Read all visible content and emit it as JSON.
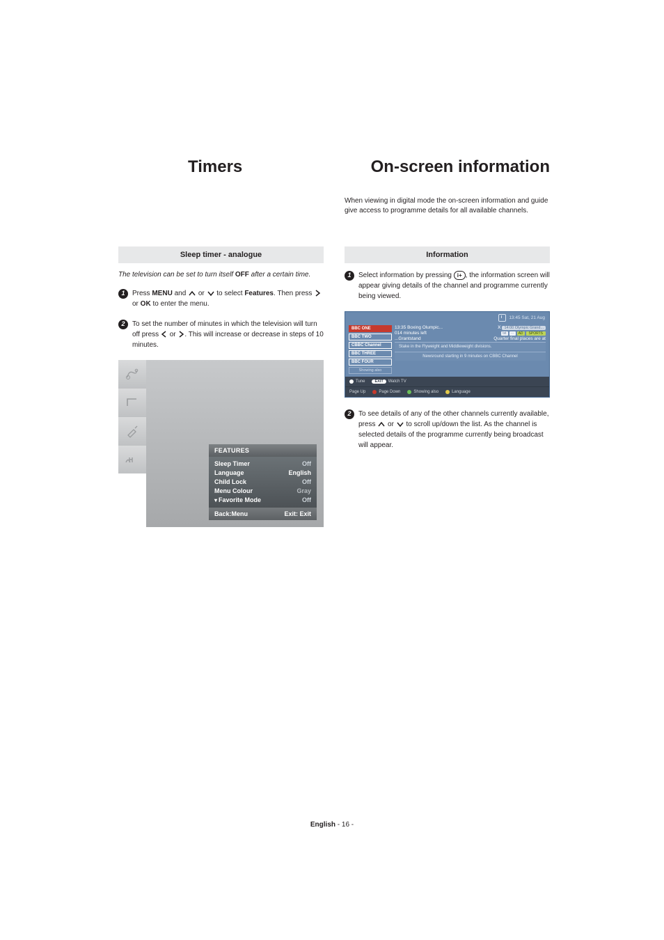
{
  "titles": {
    "left": "Timers",
    "right": "On-screen information"
  },
  "right_intro": "When viewing in digital mode the on-screen information and guide give access to programme details for all available channels.",
  "left": {
    "section": "Sleep timer - analogue",
    "lead_a": "The television can be set to turn itself ",
    "lead_off": "OFF",
    "lead_b": " after a certain time.",
    "step1_a": "Press ",
    "step1_menu": "MENU",
    "step1_b": " and ",
    "step1_c": " or ",
    "step1_d": " to select ",
    "step1_features": "Features",
    "step1_e": ". Then press ",
    "step1_f": " or ",
    "step1_ok": "OK",
    "step1_g": " to enter the menu.",
    "step2_a": "To set the number of minutes in which the television will turn off press ",
    "step2_b": " or ",
    "step2_c": ". This will increase or decrease in steps of 10 minutes."
  },
  "osd": {
    "title": "FEATURES",
    "rows": {
      "sleep_label": "Sleep Timer",
      "sleep_val": "Off",
      "lang_label": "Language",
      "lang_val": "English",
      "child_label": "Child Lock",
      "child_val": "Off",
      "colour_label": "Menu Colour",
      "colour_val": "Gray",
      "fav_label": "Favorite Mode",
      "fav_val": "Off"
    },
    "foot_left": "Back:Menu",
    "foot_right": "Exit: Exit"
  },
  "right": {
    "section": "Information",
    "step1_a": "Select information by pressing ",
    "step1_icon": "i+",
    "step1_b": ", the information screen will appear giving details of the channel and programme currently being viewed.",
    "step2": "To see details of any of the other channels currently available, press        or        to scroll up/down the list. As the channel is selected details of the programme currently being broadcast will appear.",
    "step2_a": "To see details of any of the other channels currently available, press ",
    "step2_b": " or ",
    "step2_c": " to scroll up/down the list. As the channel is selected details of the programme currently being broadcast will appear."
  },
  "epg": {
    "time": "13:45 Sat, 21 Aug",
    "channels": [
      "BBC ONE",
      "BBC TWO",
      "CBBC Channel",
      "BBC THREE",
      "BBC FOUR"
    ],
    "showing_also_chip": "Showing also",
    "now_title": "13:35 Boxing Olumpic...",
    "next_title": "14:00 Olympic Grand...",
    "next_x": "X",
    "time_left": "014 minutes left",
    "badge1": "txt",
    "badge2": "⋯",
    "badge3": "AD",
    "badge4": "SPORTS",
    "series": "...Grantstand",
    "quarter": "Quarter final places are at",
    "stake": "Stake in the Flyweight and Middleweight divisions.",
    "newsround": "Newsround starting in 9 minutes on CBBC Channel",
    "foot": {
      "tune": "Tune",
      "exit": "EXIT",
      "watch": "Watch TV",
      "pageup": "Page Up",
      "pagedown": "Page Down",
      "showing": "Showing also",
      "language": "Language"
    }
  },
  "footer": {
    "lang": "English",
    "page": "  - 16 -"
  }
}
